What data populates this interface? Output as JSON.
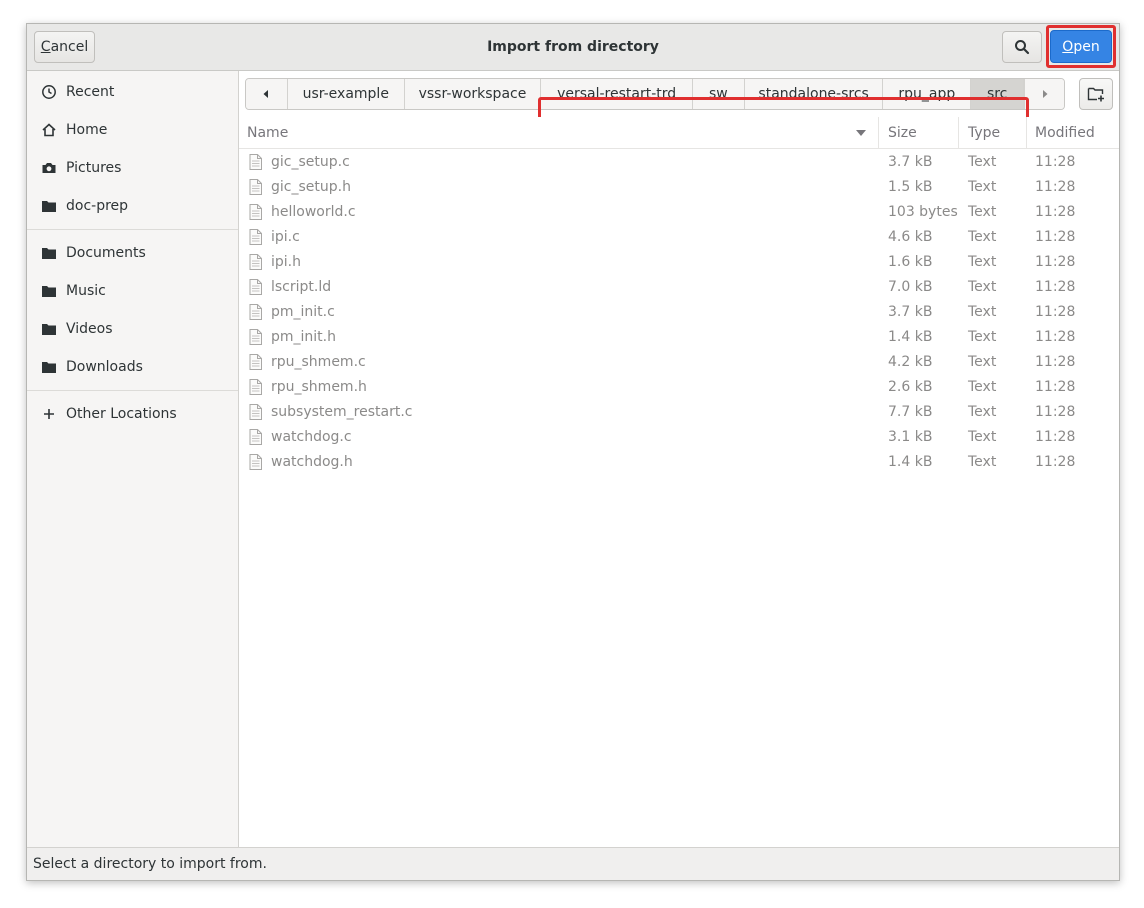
{
  "window": {
    "title": "Import from directory"
  },
  "header": {
    "cancel_mnemonic": "C",
    "cancel_rest": "ancel",
    "open_mnemonic": "O",
    "open_rest": "pen",
    "search_icon": "search-icon"
  },
  "sidebar": {
    "items": [
      {
        "label": "Recent",
        "icon": "clock-icon"
      },
      {
        "label": "Home",
        "icon": "home-icon"
      },
      {
        "label": "Pictures",
        "icon": "camera-icon"
      },
      {
        "label": "doc-prep",
        "icon": "folder-icon"
      },
      {
        "label": "Documents",
        "icon": "folder-icon"
      },
      {
        "label": "Music",
        "icon": "folder-icon"
      },
      {
        "label": "Videos",
        "icon": "folder-icon"
      },
      {
        "label": "Downloads",
        "icon": "folder-icon"
      },
      {
        "label": "Other Locations",
        "icon": "plus-icon"
      }
    ]
  },
  "pathbar": {
    "crumbs": [
      "usr-example",
      "vssr-workspace",
      "versal-restart-trd",
      "sw",
      "standalone-srcs",
      "rpu_app",
      "src"
    ],
    "active": "src"
  },
  "list": {
    "columns": {
      "name": "Name",
      "size": "Size",
      "type": "Type",
      "modified": "Modified"
    },
    "rows": [
      {
        "name": "gic_setup.c",
        "size": "3.7 kB",
        "type": "Text",
        "modified": "11:28"
      },
      {
        "name": "gic_setup.h",
        "size": "1.5 kB",
        "type": "Text",
        "modified": "11:28"
      },
      {
        "name": "helloworld.c",
        "size": "103 bytes",
        "type": "Text",
        "modified": "11:28"
      },
      {
        "name": "ipi.c",
        "size": "4.6 kB",
        "type": "Text",
        "modified": "11:28"
      },
      {
        "name": "ipi.h",
        "size": "1.6 kB",
        "type": "Text",
        "modified": "11:28"
      },
      {
        "name": "lscript.ld",
        "size": "7.0 kB",
        "type": "Text",
        "modified": "11:28"
      },
      {
        "name": "pm_init.c",
        "size": "3.7 kB",
        "type": "Text",
        "modified": "11:28"
      },
      {
        "name": "pm_init.h",
        "size": "1.4 kB",
        "type": "Text",
        "modified": "11:28"
      },
      {
        "name": "rpu_shmem.c",
        "size": "4.2 kB",
        "type": "Text",
        "modified": "11:28"
      },
      {
        "name": "rpu_shmem.h",
        "size": "2.6 kB",
        "type": "Text",
        "modified": "11:28"
      },
      {
        "name": "subsystem_restart.c",
        "size": "7.7 kB",
        "type": "Text",
        "modified": "11:28"
      },
      {
        "name": "watchdog.c",
        "size": "3.1 kB",
        "type": "Text",
        "modified": "11:28"
      },
      {
        "name": "watchdog.h",
        "size": "1.4 kB",
        "type": "Text",
        "modified": "11:28"
      }
    ]
  },
  "status": {
    "text": "Select a directory to import from."
  },
  "colors": {
    "accent": "#3584e4",
    "highlight": "#e02f2f"
  }
}
